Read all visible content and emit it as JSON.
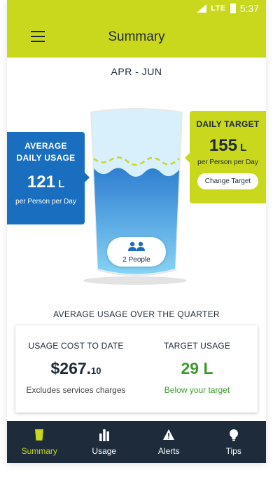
{
  "status_bar": {
    "network": "LTE",
    "time": "5:37"
  },
  "header": {
    "title": "Summary"
  },
  "period": "APR - JUN",
  "average_card": {
    "title_line1": "AVERAGE",
    "title_line2": "DAILY USAGE",
    "value": "121",
    "unit": "L",
    "subtitle": "per Person per Day"
  },
  "target_card": {
    "title": "DAILY TARGET",
    "value": "155",
    "unit": "L",
    "subtitle": "per Person per Day",
    "button_label": "Change Target"
  },
  "household": {
    "people_label": "2 People"
  },
  "section_heading": "AVERAGE USAGE OVER THE QUARTER",
  "usage_cost": {
    "title": "USAGE COST TO DATE",
    "value_dollars": "$267.",
    "value_cents": "10",
    "note": "Excludes services charges"
  },
  "target_usage": {
    "title": "TARGET USAGE",
    "value": "29 L",
    "note": "Below your target"
  },
  "nav": [
    {
      "label": "Summary",
      "icon": "glass-icon",
      "active": true
    },
    {
      "label": "Usage",
      "icon": "bar-chart-icon",
      "active": false
    },
    {
      "label": "Alerts",
      "icon": "alert-icon",
      "active": false
    },
    {
      "label": "Tips",
      "icon": "lightbulb-icon",
      "active": false
    }
  ],
  "colors": {
    "accent": "#c9d81c",
    "usage_blue": "#1a6ebf",
    "nav_bg": "#1d2b3b",
    "positive_green": "#3f9a2e"
  }
}
